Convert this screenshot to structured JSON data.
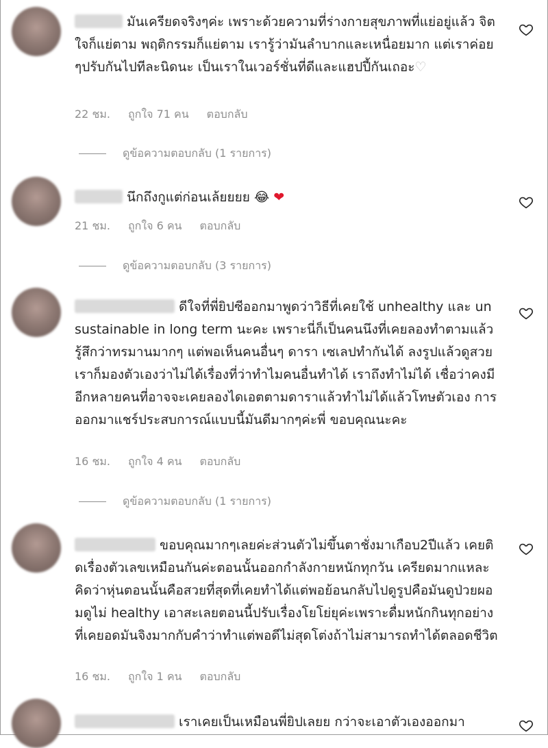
{
  "comments": [
    {
      "text": "มันเครียดจริงๆค่ะ เพราะด้วยความที่ร่างกายสุขภาพที่แย่อยู่แล้ว จิตใจก็แย่ตาม พฤติกรรมก็แย่ตาม เรารู้ว่ามันลำบากและเหนื่อยมาก แต่เราค่อยๆปรับกันไปทีละนิดนะ เป็นเราในเวอร์ชั่นที่ดีและแฮปปี้กันเถอะ",
      "trailing_emoji": "♡",
      "time": "22 ชม.",
      "likes": "ถูกใจ 71 คน",
      "reply": "ตอบกลับ",
      "view_replies": "ดูข้อความตอบกลับ (1 รายการ)"
    },
    {
      "text": "นึกถึงกูแต่ก่อนเล้ยยยย",
      "trailing_emoji": "😂",
      "trailing_emoji_2": "❤",
      "time": "21 ชม.",
      "likes": "ถูกใจ 6 คน",
      "reply": "ตอบกลับ",
      "view_replies": "ดูข้อความตอบกลับ (3 รายการ)"
    },
    {
      "text": "ดีใจที่พี่ยิปซีออกมาพูดว่าวิธีที่เคยใช้ unhealthy และ unsustainable in long term นะคะ เพราะนี่ก็เป็นคนนึงที่เคยลองทำตามแล้วรู้สึกว่าทรมานมากๆ แต่พอเห็นคนอื่นๆ ดารา เซเลปทำกันได้ ลงรูปแล้วดูสวย เราก็มองตัวเองว่าไม่ได้เรื่องที่ว่าทำไมคนอื่นทำได้ เราถึงทำไม่ได้ เชื่อว่าคงมีอีกหลายคนที่อาจจะเคยลองไดเอตตามดาราแล้วทำไม่ได้แล้วโทษตัวเอง การออกมาแชร์ประสบการณ์แบบนี้มันดีมากๆค่ะพี่ ขอบคุณนะคะ",
      "time": "16 ชม.",
      "likes": "ถูกใจ 4 คน",
      "reply": "ตอบกลับ",
      "view_replies": "ดูข้อความตอบกลับ (1 รายการ)"
    },
    {
      "text": "ขอบคุณมากๆเลยค่ะส่วนตัวไม่ขึ้นตาชั่งมาเกือบ2ปีแล้ว เคยติดเรื่องตัวเลขเหมือนกันค่ะตอนนั้นออกกำลังกายหนักทุกวัน เครียดมากแหละคิดว่าหุ่นตอนนั้นคือสวยที่สุดที่เคยทำได้แต่พอย้อนกลับไปดูรูปคือมันดูป่วยผอมดูไม่ healthy เอาสะเลยตอนนี้ปรับเรื่องโยโย่ยุค่ะเพราะดื่มหนักกินทุกอย่างที่เคยอดมันจิงมากกับคำว่าทำแต่พอดีไม่สุดโต่งถ้าไม่สามารถทำได้ตลอดชีวิต",
      "time": "16 ชม.",
      "likes": "ถูกใจ 1 คน",
      "reply": "ตอบกลับ"
    },
    {
      "text": "เราเคยเป็นเหมือนพี่ยิปเลยย กว่าจะเอาตัวเองออกมา"
    }
  ]
}
